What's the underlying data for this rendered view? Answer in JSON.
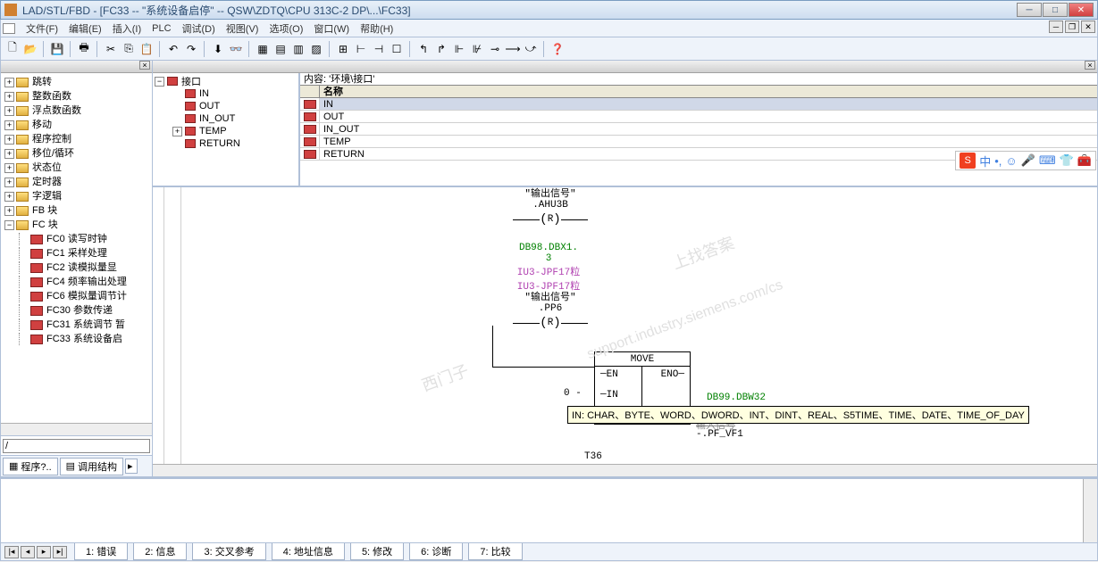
{
  "title": "LAD/STL/FBD  - [FC33 -- \"系统设备启停\" -- QSW\\ZDTQ\\CPU 313C-2 DP\\...\\FC33]",
  "menu": [
    "文件(F)",
    "编辑(E)",
    "插入(I)",
    "PLC",
    "调试(D)",
    "视图(V)",
    "选项(O)",
    "窗口(W)",
    "帮助(H)"
  ],
  "left_tree": {
    "folders": [
      "跳转",
      "整数函数",
      "浮点数函数",
      "移动",
      "程序控制",
      "移位/循环",
      "状态位",
      "定时器",
      "字逻辑",
      "FB 块"
    ],
    "fc_folder": "FC 块",
    "fc_items": [
      "FC0   读写时钟",
      "FC1   采样处理",
      "FC2   读模拟量显",
      "FC4   频率输出处理",
      "FC6   模拟量调节计",
      "FC30   参数传递",
      "FC31   系统调节 暂",
      "FC33   系统设备启"
    ]
  },
  "left_input": "/",
  "left_tabs": {
    "tab1": "程序?..",
    "tab2": "调用结构"
  },
  "iface_tree": {
    "root": "接口",
    "children": [
      "IN",
      "OUT",
      "IN_OUT",
      "TEMP",
      "RETURN"
    ]
  },
  "iface_grid": {
    "title": "内容: '环境\\接口'",
    "header": "名称",
    "rows": [
      "IN",
      "OUT",
      "IN_OUT",
      "TEMP",
      "RETURN"
    ]
  },
  "ladder": {
    "coil1": {
      "l1": "\"输出信号\"",
      "l2": ".AHU3B",
      "type": "R"
    },
    "db1": {
      "l1": "DB98.DBX1.",
      "l2": "3",
      "l3": "IU3-JPF17粒",
      "l4": "IU3-JPF17粒"
    },
    "coil2": {
      "l1": "\"输出信号\"",
      "l2": ".PP6",
      "type": "R"
    },
    "move": {
      "title": "MOVE",
      "en": "EN",
      "eno": "ENO",
      "in": "IN",
      "out": "OUT",
      "in_val": "0 -"
    },
    "out_db": "DB99.DBW32",
    "out_var": "-.PF_VF1",
    "out_lbl": "输入信号",
    "tnum": "T36",
    "tooltip": "IN: CHAR、BYTE、WORD、DWORD、INT、DINT、REAL、S5TIME、TIME、DATE、TIME_OF_DAY"
  },
  "bottom_tabs": [
    "1: 错误",
    "2: 信息",
    "3: 交叉参考",
    "4: 地址信息",
    "5: 修改",
    "6: 诊断",
    "7: 比较"
  ],
  "ime": "中",
  "watermarks": [
    "西门子",
    "上找答案",
    "support.industry.siemens.com/cs"
  ]
}
